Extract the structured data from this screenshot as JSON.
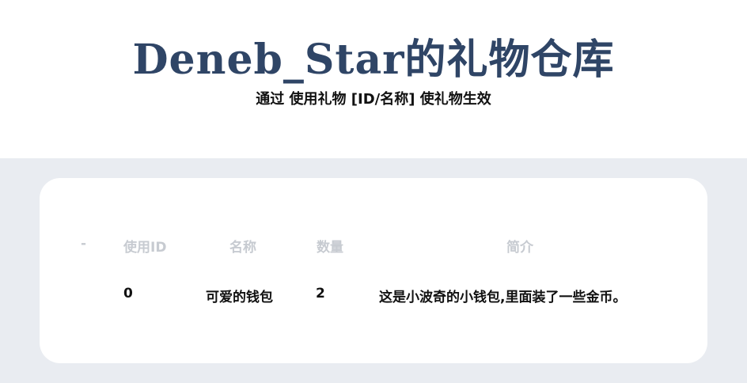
{
  "header": {
    "title": "Deneb_Star的礼物仓库",
    "subtitle": "通过 使用礼物 [ID/名称] 使礼物生效"
  },
  "table": {
    "columns": [
      "-",
      "使用ID",
      "名称",
      "数量",
      "简介"
    ],
    "rows": [
      {
        "dash": "",
        "id": "0",
        "name": "可爱的钱包",
        "quantity": "2",
        "description": "这是小波奇的小钱包,里面装了一些金币。"
      }
    ]
  },
  "colors": {
    "title": "#2f4566",
    "background": "#e9ecf1",
    "header_text": "#c7cbd1"
  }
}
